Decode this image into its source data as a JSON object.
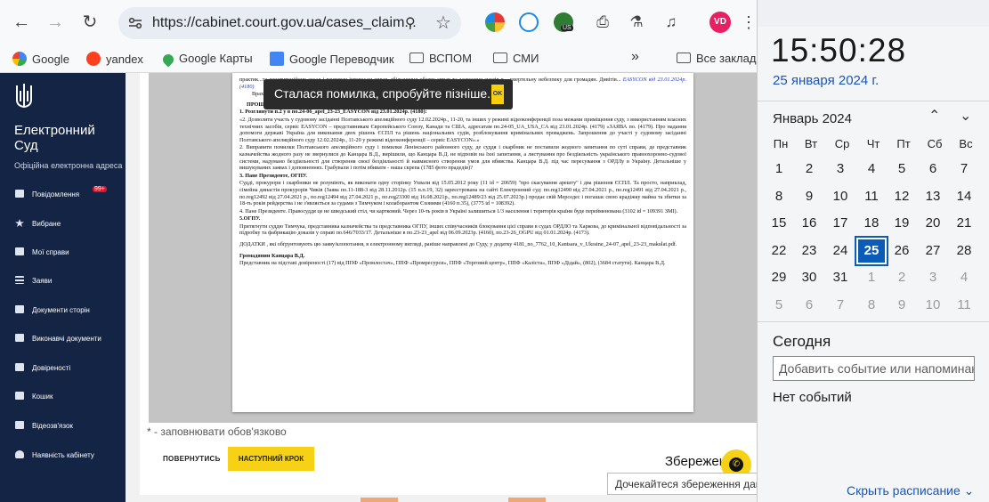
{
  "browser": {
    "url": "https://cabinet.court.gov.ua/cases_claim...",
    "avatar_initials": "VD",
    "ext_badge": "US",
    "bookmarks": [
      {
        "label": "Google"
      },
      {
        "label": "yandex"
      },
      {
        "label": "Google Карты"
      },
      {
        "label": "Google Переводчик"
      },
      {
        "label": "ВСПОМ"
      },
      {
        "label": "СМИ"
      }
    ],
    "overflow": "»",
    "all_bookmarks": "Все закладки"
  },
  "sidebar": {
    "brand_line1": "Електронний",
    "brand_line2": "Суд",
    "brand_sub": "Офіційна електронна адреса",
    "items": [
      {
        "label": "Повідомлення",
        "badge": "99+"
      },
      {
        "label": "Вибране"
      },
      {
        "label": "Мої справи"
      },
      {
        "label": "Заяви"
      },
      {
        "label": "Документи сторін"
      },
      {
        "label": "Виконавчі документи"
      },
      {
        "label": "Довіреності"
      },
      {
        "label": "Кошик"
      },
      {
        "label": "Відеозв'язок"
      },
      {
        "label": "Наявність кабінету"
      }
    ]
  },
  "toast": {
    "message": "Сталася помилка, спробуйте пізніше.",
    "ok": "OK"
  },
  "document": {
    "top_lines": "практик...та конституційних засад і всупереч інтересам справ, збільшення обсягу справ та засвоєння суддів в... смертельну небезпеку для громадян. Дивітів...",
    "top_link": "EASYCON від 23.01.2024р. (4180)",
    "top_tail": "Врах...",
    "ask_header": "ПРОШУ Суд:",
    "item1_head": "1. Розглянути п.2 у в по.24-06_apel_23-23_EASYCON від 23.01.2024р. (4180):",
    "item1_body": "«2. Дозволити участь у судовому засіданні Полтавського апеляційного суду 12.02.2024р., 11-20, та інших у режимі відеоконференції поза межами приміщення суду, з використанням власних технічних засобів, сервіс EASYCON – представникам Європейського Союзу, Канади та США, адресатам по.24-05_UA_USA_CA від 23.01.2024р. (4179) «ЗАЯВА по. (4179). Про надання допомоги державі Україна для виконання двох рішень ЄСПЛ та рішень національних судів, розблокування кримінальних проваджень. Запрошення до участі у судовому засіданні Полтавського апеляційного суду 12.02.2024р., 11-20 у режимі відеоконференції – сервіс EASYCON».»",
    "item2": "2. Виправити помилки Полтавського апеляційного суду і помилки Ленінського районного суду, де суддя і скарбник не поставили жодного запитання по суті справи, де представник казначейства жодного разу не звернулися до Канцара В.Д., вирішили, що Канцара В.Д. не відповів на їхні запитання, а листування про бездіяльність українського правоохоронно-судової системи, надумано бездіяльності для створення своєї бездіяльності й навмисного створення умов для вбивства. Канцара В.Д. під час пересування з ОРДЛу в Україну. Детальніше у вишукуваних заявах і доповненнях. Грабували і потім вбивати - наша скрепа (1785 фото прадедів)?",
    "item3_head": "3. Пане Президенте, ОГПУ.",
    "item3_body": "Судді, прокурори і скарбники не розуміють, як виконати одну сторінку Ухвали від 15.05.2012 року (11 id = 20659) \"про скасування арешту\" і два рішення ЄСПЛ. Та просто, наприклад, сімейна династія прокурорів Чиків (Заява по.11-188-3 від 28.11.2012р. (15 п.п.19, 32) зареєстрована на сайті Електронний суд: по.reg12490 від 27.04.2021 р., по.reg12491 від 27.04.2021 р., по.reg12492 від 27.04.2021 р., по.reg12494 від 27.04.2021 р., по.reg23300 від 16.08.2021р., по.reg12489/23 від 25.07.2023р.) продає свій Мерседес і погашає свою крадіжку майна та збитки за 18-ть років рейдерства і не з'являється за судами з Тимчуком і колаборантом Єховими (4160 п.35), (3775 id = 108392).",
    "item4": "4. Пане Президенте. Правосуддя це не шведський стіл, чи картковий. Через 10-ть років в Україні залишиться 1/3 населення і територія країни буде перейменована (3102 id = 109391 ЗМІ).",
    "item5_head": "5.ОГПУ.",
    "item5_body": "Притягнути суддю Тимчука, представника казначейства та представника ОГПУ, інших співучасників блокування цієї справи в судах ОРДЛО та Харкова, до кримінальної відповідальності за підробку та фабрикацію доказів у справі по.646/7033/17. Детальніше в по.23-23_apel від 06.09.2023р. (4160), по.23-26_OGPU від 01.01.2024р. (4173).",
    "addenda": "ДОДАТКИ , які обґрунтовують цю заяву/клопотання, в електронному вигляді, раніше направлені до Суду, у додатку 4181_no_7762_10_Kantsara_v_Ukraine_24-07_apel_23-23_makulat.pdf.",
    "sign1": "Громадянин Канцара В.Д.",
    "sign2": "Представник на підставі довіреності (17) від ППФ «Промлостач», ППФ «Промресурси», ППФ «Торговий центр», ППФ «Каліста», ППФ «Дідай», (802), (3684 статути). Канцара В.Д."
  },
  "form": {
    "required_note": "* - заповнювати обов'язково",
    "back": "ПОВЕРНУТИСЬ",
    "next": "НАСТУПНИЙ КРОК",
    "save_label": "Збережен",
    "saving_tooltip": "Дочекайтеся збереження даних"
  },
  "calendar": {
    "time": "15:50:28",
    "date": "25 января 2024 г.",
    "month": "Январь 2024",
    "weekdays": [
      "Пн",
      "Вт",
      "Ср",
      "Чт",
      "Пт",
      "Сб",
      "Вс"
    ],
    "weeks": [
      [
        "1",
        "2",
        "3",
        "4",
        "5",
        "6",
        "7"
      ],
      [
        "8",
        "9",
        "10",
        "11",
        "12",
        "13",
        "14"
      ],
      [
        "15",
        "16",
        "17",
        "18",
        "19",
        "20",
        "21"
      ],
      [
        "22",
        "23",
        "24",
        "25",
        "26",
        "27",
        "28"
      ],
      [
        "29",
        "30",
        "31",
        "1",
        "2",
        "3",
        "4"
      ],
      [
        "5",
        "6",
        "7",
        "8",
        "9",
        "10",
        "11"
      ]
    ],
    "today_label": "Сегодня",
    "event_placeholder": "Добавить событие или напоминание",
    "no_events": "Нет событий",
    "hide_schedule": "Скрыть расписание"
  },
  "colors": {
    "sidebar_bg": "#132444",
    "accent_yellow": "#f7d116",
    "today_blue": "#0b5cb8",
    "link_blue": "#1856b8"
  }
}
